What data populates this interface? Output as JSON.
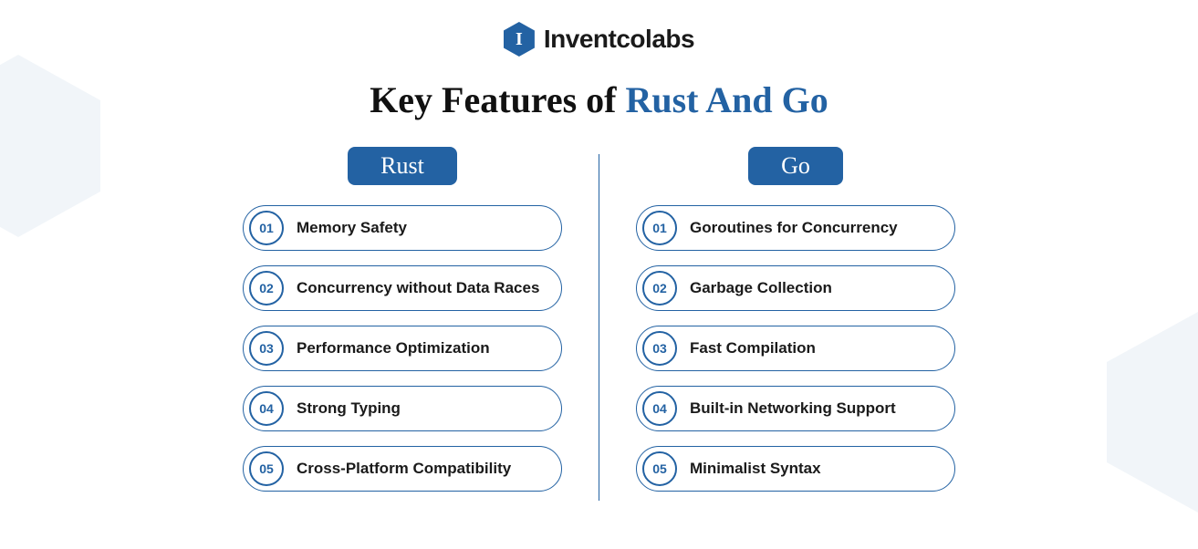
{
  "brand": {
    "logo_letter": "I",
    "logo_text": "Inventcolabs"
  },
  "title": {
    "prefix": "Key Features of ",
    "accent": "Rust And Go"
  },
  "columns": [
    {
      "header": "Rust",
      "features": [
        {
          "num": "01",
          "text": "Memory Safety"
        },
        {
          "num": "02",
          "text": "Concurrency without Data Races"
        },
        {
          "num": "03",
          "text": "Performance Optimization"
        },
        {
          "num": "04",
          "text": "Strong Typing"
        },
        {
          "num": "05",
          "text": "Cross-Platform Compatibility"
        }
      ]
    },
    {
      "header": "Go",
      "features": [
        {
          "num": "01",
          "text": "Goroutines for Concurrency"
        },
        {
          "num": "02",
          "text": "Garbage Collection"
        },
        {
          "num": "03",
          "text": "Fast Compilation"
        },
        {
          "num": "04",
          "text": "Built-in Networking Support"
        },
        {
          "num": "05",
          "text": "Minimalist Syntax"
        }
      ]
    }
  ]
}
